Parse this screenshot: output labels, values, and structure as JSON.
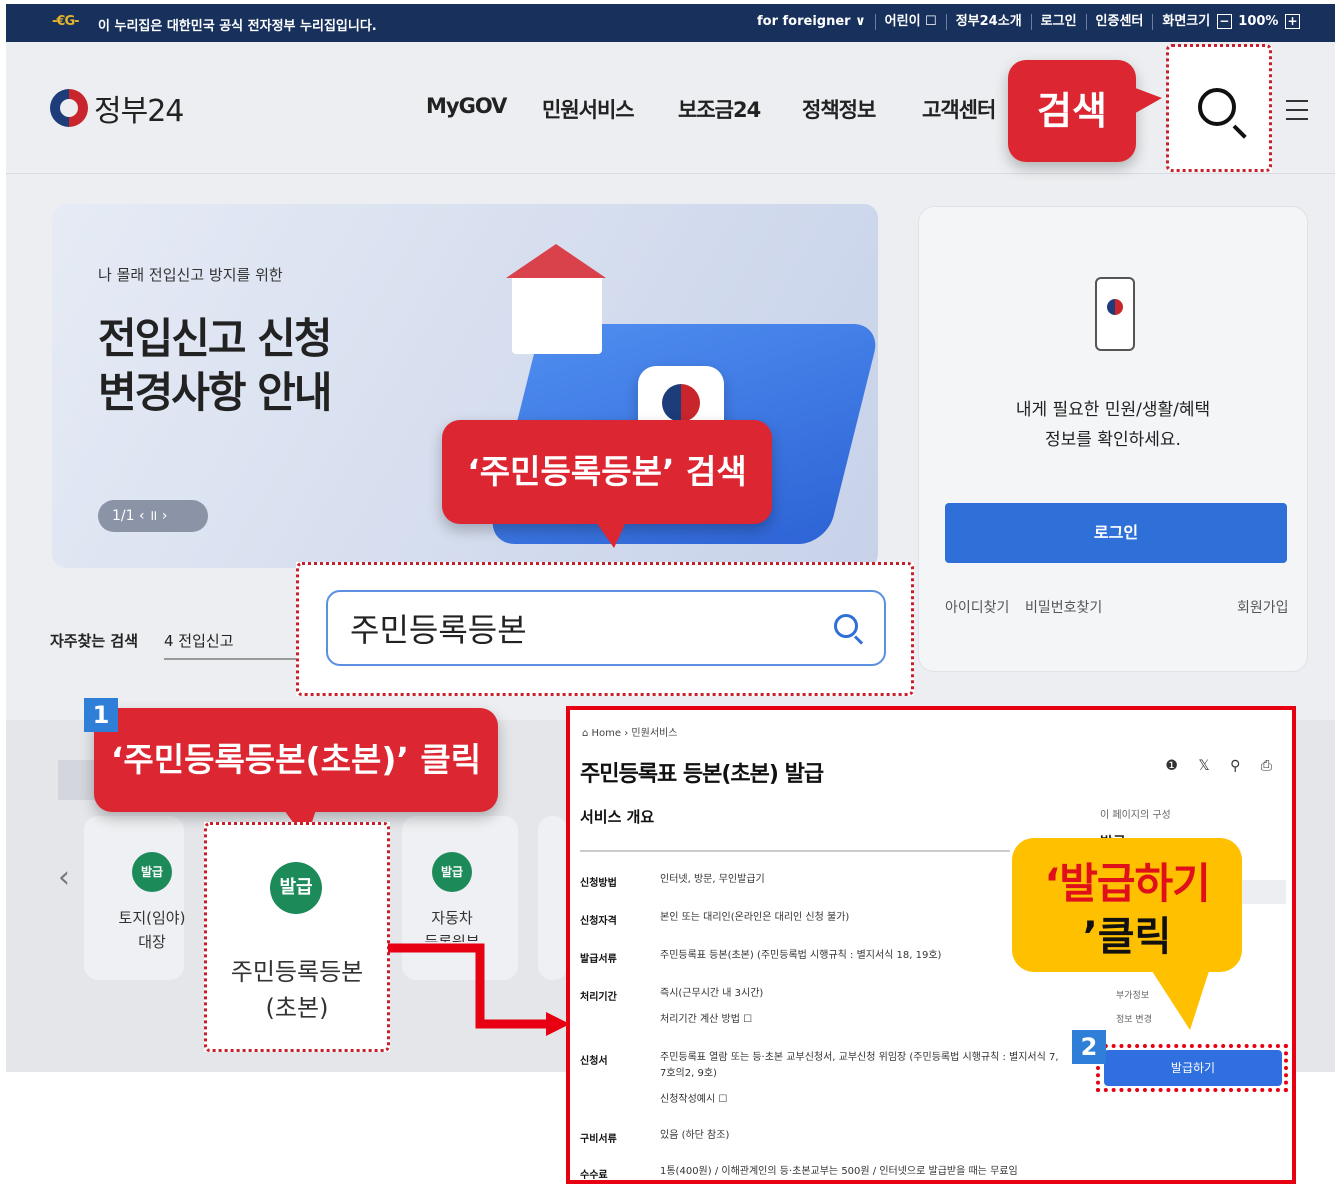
{
  "topbar": {
    "logo_text": "-€G-",
    "notice": "이 누리집은 대한민국 공식 전자정부 누리집입니다.",
    "links": [
      "for foreigner ∨",
      "어린이 ☐",
      "정부24소개",
      "로그인",
      "인증센터"
    ],
    "font_size_label": "화면크기",
    "zoom_minus": "−",
    "zoom_value": "100%",
    "zoom_plus": "+"
  },
  "header": {
    "logo_text": "정부24",
    "nav": [
      "MyGOV",
      "민원서비스",
      "보조금24",
      "정책정보",
      "고객센터"
    ],
    "menu_icon": "hamburger-menu-icon",
    "search_icon": "search-icon"
  },
  "hero": {
    "sub": "나 몰래 전입신고 방지를 위한",
    "title_line1": "전입신고 신청",
    "title_line2": "변경사항 안내",
    "pager": "1/1  ‹  ॥  ›"
  },
  "login_card": {
    "message": "내게 필요한 민원/생활/혜택\n정보를 확인하세요.",
    "login_button": "로그인",
    "find_id": "아이디찾기",
    "find_pw": "비밀번호찾기",
    "signup": "회원가입"
  },
  "frequent": {
    "label": "자주찾는 검색",
    "item": "4 전입신고"
  },
  "search": {
    "value": "주민등록등본"
  },
  "services": [
    {
      "badge": "발급",
      "label": "토지(임야)\n대장"
    },
    {
      "badge": "발급",
      "label": "주민등록등본\n(초본)"
    },
    {
      "badge": "발급",
      "label": "자동차\n등록원부"
    }
  ],
  "carousel": {
    "prev": "‹",
    "next": "›"
  },
  "annotations": {
    "search_callout": "검색",
    "keyword_callout": "‘주민등록등본’ 검색",
    "step1_num": "1",
    "step1_callout": "‘주민등록등본(초본)’ 클릭",
    "step2_num": "2",
    "step2_line1": "‘발급하기",
    "step2_line2": "’클릭"
  },
  "detail": {
    "breadcrumb": "⌂ Home  ›  민원서비스",
    "title": "주민등록표 등본(초본) 발급",
    "share_icons": "❶ 𝕏 ⚲ ⎙",
    "overview": "서비스 개요",
    "toc_head": "이 페이지의 구성",
    "toc_item": "발급",
    "toc_small1": "부가정보",
    "toc_small2": "정보 변경",
    "issue_button": "발급하기",
    "rows": [
      {
        "label": "신청방법",
        "value": "인터넷, 방문, 무인발급기"
      },
      {
        "label": "신청자격",
        "value": "본인 또는 대리인(온라인은 대리인 신청 불가)"
      },
      {
        "label": "발급서류",
        "value": "주민등록표 등본(초본) (주민등록법 시행규칙 : 별지서식 18, 19호)"
      },
      {
        "label": "처리기간",
        "value": "즉시(근무시간 내 3시간)"
      },
      {
        "label": "",
        "value": "처리기간 계산 방법 ☐"
      },
      {
        "label": "신청서",
        "value": "주민등록표 열람 또는 등·초본 교부신청서, 교부신청 위임장 (주민등록법 시행규칙 : 별지서식 7, 7호의2, 9호)"
      },
      {
        "label": "",
        "value": "신청작성예시 ☐"
      },
      {
        "label": "구비서류",
        "value": "있음 (하단 참조)"
      },
      {
        "label": "수수료",
        "value": "1통(400원) / 이해관계인의 등·초본교부는 500원 / 인터넷으로 발급받을 때는 무료임"
      }
    ]
  },
  "colors": {
    "topbar": "#17305c",
    "accent_blue": "#2f70d8",
    "callout_red": "#dc2632",
    "callout_yellow": "#ffc000",
    "badge_green": "#1d8a5a"
  }
}
